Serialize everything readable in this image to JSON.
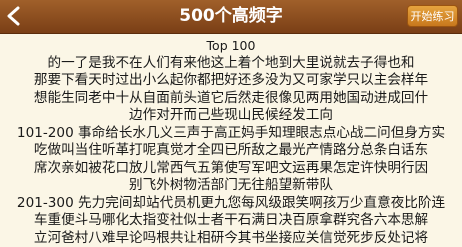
{
  "header": {
    "title": "500个高频字",
    "start_button_label": "开始练习",
    "back_icon": "back-arrow-icon"
  },
  "content": {
    "heading": "Top 100",
    "lines": [
      "的一了是我不在人们有来他这上着个地到大里说就去子得也和",
      "那要下看天时过出小么起你都把好还多没为又可家学只以主会样年",
      "想能生同老中十从自面前头道它后然走很像见两用她国动进成回什",
      "边作对开而己些现山民候经发工向",
      "101-200 事命给长水几义三声于高正妈手知理眼志点心战二问但身方实",
      "吃做叫当住听革打呢真觉才全四已所敌之最光产情路分总条白话东",
      "席次亲如被花口放儿常西气五第使写军吧文运再果怎定许快明行因",
      "别飞外树物活部门无往船望新带队",
      "201-300 先力完间却站代员机更九您每风级跟笑啊孩万少直意夜比阶连",
      "车重便斗马哪化太指变社似士者干石满日决百原拿群究各六本思解",
      "立河爸村八难早论吗根共让相研今其书坐接应关信觉死步反处记将"
    ]
  }
}
